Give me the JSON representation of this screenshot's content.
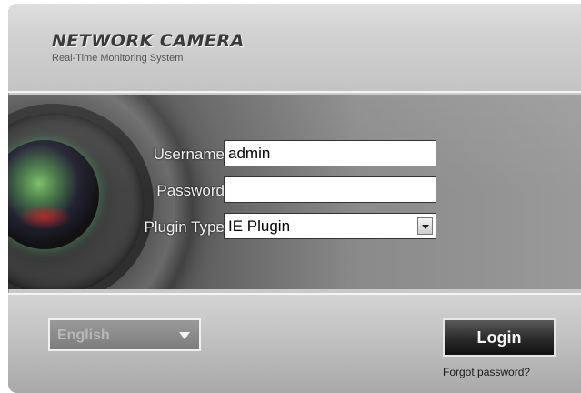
{
  "header": {
    "title": "NETWORK CAMERA",
    "subtitle": "Real-Time Monitoring System"
  },
  "form": {
    "username_label": "Username",
    "username_value": "admin",
    "password_label": "Password",
    "password_value": "",
    "plugin_label": "Plugin Type",
    "plugin_value": "IE Plugin",
    "colon": ":"
  },
  "footer": {
    "language": "English",
    "login_label": "Login",
    "forgot_label": "Forgot password?"
  },
  "icons": {
    "language_caret": "chevron-down-icon",
    "select_caret": "chevron-down-icon"
  }
}
